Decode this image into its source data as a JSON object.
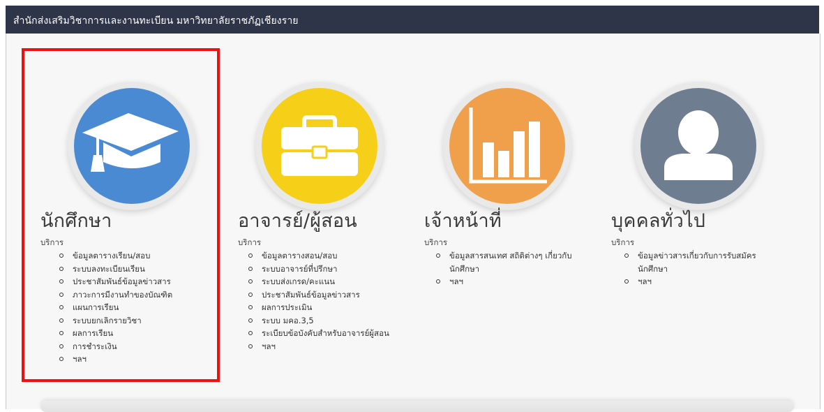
{
  "header": {
    "title": "สำนักส่งเสริมวิชาการและงานทะเบียน มหาวิทยาลัยราชภัฏเชียงราย"
  },
  "colors": {
    "header_bg": "#2e3548",
    "student": "#4a8ad3",
    "teacher": "#f6cf18",
    "staff": "#f0a04b",
    "public": "#6f7d91",
    "highlight": "#ee1111"
  },
  "sections": [
    {
      "title": "นักศึกษา",
      "icon": "graduation-cap-icon",
      "services_label": "บริการ",
      "items": [
        "ข้อมูลตารางเรียน/สอบ",
        "ระบบลงทะเบียนเรียน",
        "ประชาสัมพันธ์ข้อมูลข่าวสาร",
        "ภาวะการมีงานทำของบัณฑิต",
        "แผนการเรียน",
        "ระบบยกเลิกรายวิชา",
        "ผลการเรียน",
        "การชำระเงิน",
        "ฯลฯ"
      ]
    },
    {
      "title": "อาจารย์/ผู้สอน",
      "icon": "briefcase-icon",
      "services_label": "บริการ",
      "items": [
        "ข้อมูลตารางสอน/สอบ",
        "ระบบอาจารย์ที่ปรึกษา",
        "ระบบส่งเกรด/คะแนน",
        "ประชาสัมพันธ์ข้อมูลข่าวสาร",
        "ผลการประเมิน",
        "ระบบ มคอ.3,5",
        "ระเบียบข้อบังคับสำหรับอาจารย์ผู้สอน",
        "ฯลฯ"
      ]
    },
    {
      "title": "เจ้าหน้าที่",
      "icon": "bar-chart-icon",
      "services_label": "บริการ",
      "items": [
        "ข้อมูลสารสนเทศ สถิติต่างๆ เกี่ยวกับนักศึกษา",
        "ฯลฯ"
      ]
    },
    {
      "title": "บุคคลทั่วไป",
      "icon": "person-icon",
      "services_label": "บริการ",
      "items": [
        "ข้อมูลข่าวสารเกี่ยวกับการรับสมัครนักศึกษา",
        "ฯลฯ"
      ]
    }
  ]
}
